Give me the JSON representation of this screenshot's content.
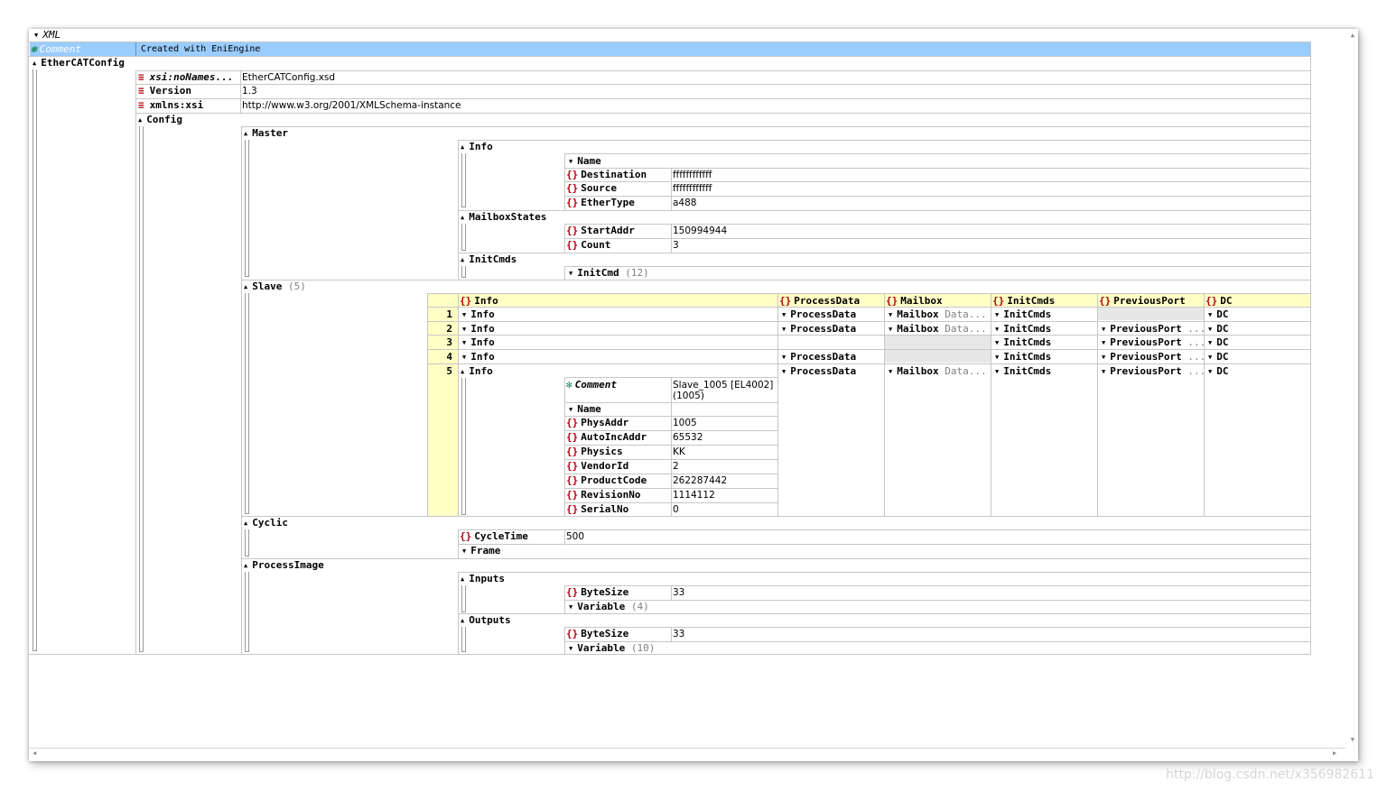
{
  "root": {
    "label": "XML"
  },
  "comment": {
    "key": "Comment",
    "value": "Created with EniEngine"
  },
  "ethercat": {
    "label": "EtherCATConfig",
    "attrs": [
      {
        "key": "xsi:noNames...",
        "value": "EtherCATConfig.xsd"
      },
      {
        "key": "Version",
        "value": "1.3"
      },
      {
        "key": "xmlns:xsi",
        "value": "http://www.w3.org/2001/XMLSchema-instance"
      }
    ]
  },
  "config": {
    "label": "Config"
  },
  "master": {
    "label": "Master",
    "info": {
      "label": "Info",
      "name": "Name",
      "destination": {
        "key": "Destination",
        "value": "ffffffffffff"
      },
      "source": {
        "key": "Source",
        "value": "ffffffffffff"
      },
      "ethertype": {
        "key": "EtherType",
        "value": "a488"
      }
    },
    "mailbox": {
      "label": "MailboxStates",
      "startaddr": {
        "key": "StartAddr",
        "value": "150994944"
      },
      "count": {
        "key": "Count",
        "value": "3"
      }
    },
    "initcmds": {
      "label": "InitCmds",
      "initcmd": "InitCmd",
      "initcmd_count": "(12)"
    }
  },
  "slave": {
    "label": "Slave",
    "count": "(5)",
    "headers": [
      "Info",
      "ProcessData",
      "Mailbox",
      "InitCmds",
      "PreviousPort",
      "DC"
    ],
    "rows": [
      {
        "n": "1",
        "info": "Info",
        "pd": "ProcessData",
        "mb": "Mailbox",
        "mbx": "Data...",
        "ic": "InitCmds",
        "pp": "",
        "dc": "DC"
      },
      {
        "n": "2",
        "info": "Info",
        "pd": "ProcessData",
        "mb": "Mailbox",
        "mbx": "Data...",
        "ic": "InitCmds",
        "pp": "PreviousPort",
        "ppx": "...",
        "dc": "DC"
      },
      {
        "n": "3",
        "info": "Info",
        "pd": "",
        "mb": "",
        "mbx": "",
        "ic": "InitCmds",
        "pp": "PreviousPort",
        "ppx": "...",
        "dc": "DC"
      },
      {
        "n": "4",
        "info": "Info",
        "pd": "ProcessData",
        "mb": "",
        "mbx": "",
        "ic": "InitCmds",
        "pp": "PreviousPort",
        "ppx": "...",
        "dc": "DC"
      },
      {
        "n": "5",
        "info": "Info",
        "pd": "ProcessData",
        "mb": "Mailbox",
        "mbx": "Data...",
        "ic": "InitCmds",
        "pp": "PreviousPort",
        "ppx": "...",
        "dc": "DC"
      }
    ],
    "detail": {
      "comment": {
        "key": "Comment",
        "value1": "Slave_1005 [EL4002]",
        "value2": "(1005)"
      },
      "name": "Name",
      "fields": [
        {
          "key": "PhysAddr",
          "value": "1005"
        },
        {
          "key": "AutoIncAddr",
          "value": "65532"
        },
        {
          "key": "Physics",
          "value": "KK"
        },
        {
          "key": "VendorId",
          "value": "2"
        },
        {
          "key": "ProductCode",
          "value": "262287442"
        },
        {
          "key": "RevisionNo",
          "value": "1114112"
        },
        {
          "key": "SerialNo",
          "value": "0"
        }
      ]
    }
  },
  "cyclic": {
    "label": "Cyclic",
    "cycletime": {
      "key": "CycleTime",
      "value": "500"
    },
    "frame": "Frame"
  },
  "processimage": {
    "label": "ProcessImage",
    "inputs": {
      "label": "Inputs",
      "bytesize": {
        "key": "ByteSize",
        "value": "33"
      },
      "variable": "Variable",
      "variable_count": "(4)"
    },
    "outputs": {
      "label": "Outputs",
      "bytesize": {
        "key": "ByteSize",
        "value": "33"
      },
      "variable": "Variable",
      "variable_count": "(10)"
    }
  },
  "watermark": "http://blog.csdn.net/x356982611",
  "colors": {
    "selection": "#99ccff",
    "grid": "#c7c7c7",
    "table_header": "#ffffc6",
    "icon_red": "#b0000b"
  }
}
